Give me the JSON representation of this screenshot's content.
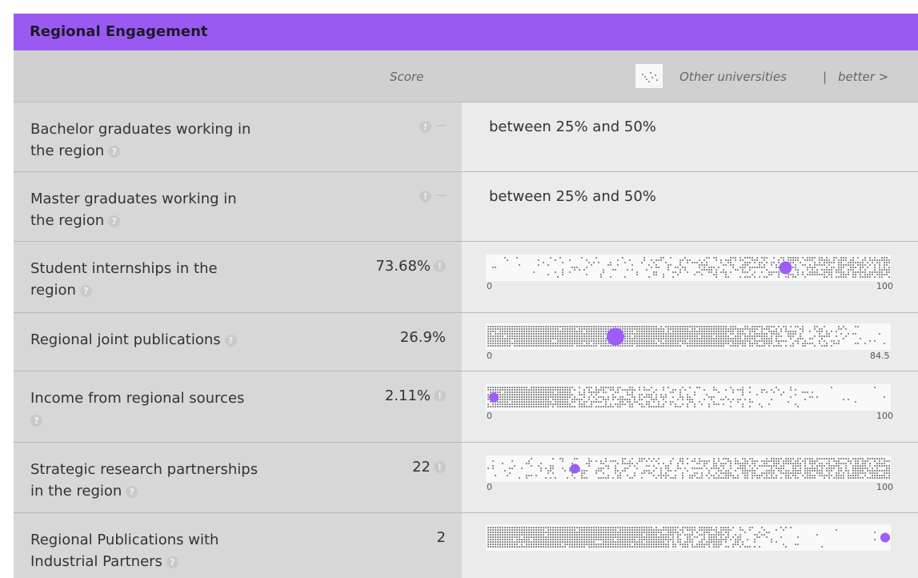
{
  "header": {
    "title": "Regional Engagement"
  },
  "columns": {
    "score": "Score",
    "other": "Other universities",
    "separator": "|",
    "better": "better >"
  },
  "rows": [
    {
      "label_line1": "Bachelor graduates working in",
      "label_line2": "the region",
      "score": "",
      "indicator": "warning-dash",
      "value_text": "between 25% and 50%"
    },
    {
      "label_line1": "Master graduates working in",
      "label_line2": "the region",
      "score": "",
      "indicator": "warning-dash",
      "value_text": "between 25% and 50%"
    },
    {
      "label_line1": "Student internships in the",
      "label_line2": "region",
      "score": "73.68%",
      "indicator": "warning",
      "dist": {
        "min_label": "0",
        "max_label": "100",
        "marker_fraction": 0.74
      }
    },
    {
      "label_line1": "Regional joint publications",
      "label_line2": "",
      "score": "26.9%",
      "indicator": "none",
      "dist": {
        "min_label": "0",
        "max_label": "84.5",
        "marker_fraction": 0.32
      }
    },
    {
      "label_line1": "Income from regional sources",
      "label_line2": "",
      "score": "2.11%",
      "indicator": "warning",
      "dist": {
        "min_label": "0",
        "max_label": "100",
        "marker_fraction": 0.02
      }
    },
    {
      "label_line1": "Strategic research partnerships",
      "label_line2": "in the region",
      "score": "22",
      "indicator": "warning",
      "dist": {
        "min_label": "0",
        "max_label": "100",
        "marker_fraction": 0.22
      }
    },
    {
      "label_line1": "Regional Publications with",
      "label_line2": "Industrial Partners",
      "score": "2",
      "indicator": "none",
      "dist": {
        "min_label": "",
        "max_label": "",
        "marker_fraction": 1.0
      }
    }
  ],
  "colors": {
    "header": "#9a5af2",
    "marker": "#9d5cf5",
    "dots": "#8f8f8f"
  },
  "icons": {
    "help": "question-circle-icon",
    "warning": "exclamation-circle-icon"
  }
}
